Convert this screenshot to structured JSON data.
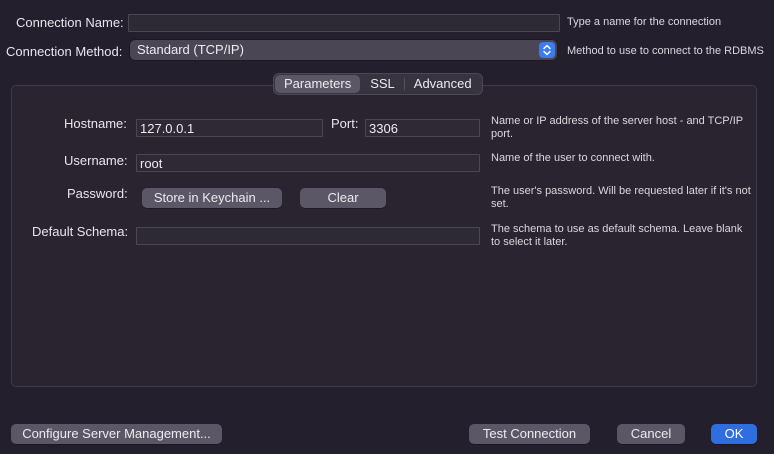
{
  "connection": {
    "name_label": "Connection Name:",
    "name_value": "",
    "name_hint": "Type a name for the connection",
    "method_label": "Connection Method:",
    "method_value": "Standard (TCP/IP)",
    "method_hint": "Method to use to connect to the RDBMS"
  },
  "tabs": [
    {
      "label": "Parameters",
      "active": true
    },
    {
      "label": "SSL",
      "active": false
    },
    {
      "label": "Advanced",
      "active": false
    }
  ],
  "parameters": {
    "hostname_label": "Hostname:",
    "hostname_value": "127.0.0.1",
    "port_label": "Port:",
    "port_value": "3306",
    "hostname_hint": "Name or IP address of the server host - and TCP/IP port.",
    "username_label": "Username:",
    "username_value": "root",
    "username_hint": "Name of the user to connect with.",
    "password_label": "Password:",
    "store_keychain_label": "Store in Keychain ...",
    "clear_label": "Clear",
    "password_hint": "The user's password. Will be requested later if it's not set.",
    "schema_label": "Default Schema:",
    "schema_value": "",
    "schema_hint": "The schema to use as default schema. Leave blank to select it later."
  },
  "footer": {
    "configure_label": "Configure Server Management...",
    "test_label": "Test Connection",
    "cancel_label": "Cancel",
    "ok_label": "OK"
  },
  "colors": {
    "background": "#241f2d",
    "accent": "#2f6ee0"
  }
}
